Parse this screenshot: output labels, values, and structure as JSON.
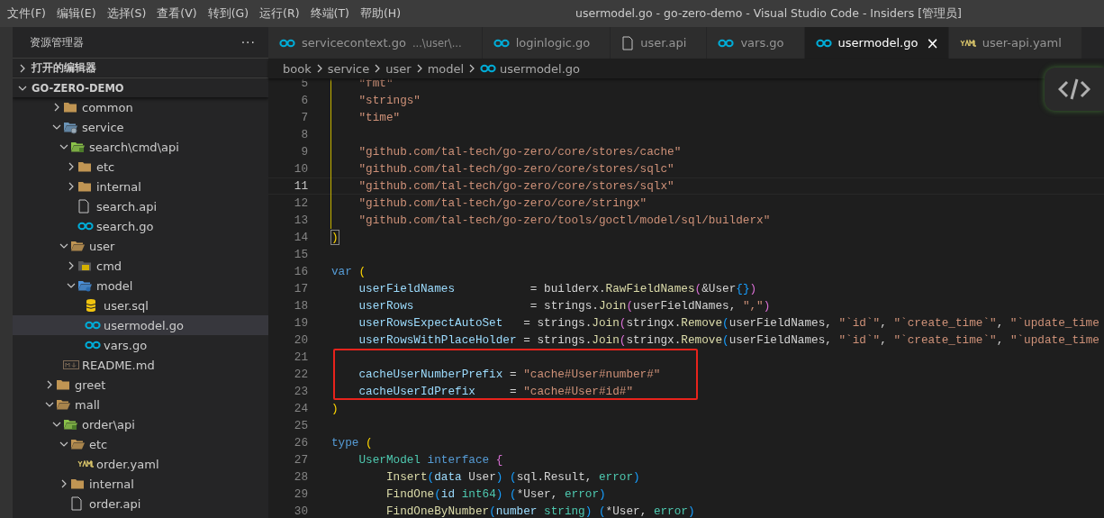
{
  "window": {
    "title": "usermodel.go - go-zero-demo - Visual Studio Code - Insiders [管理员]"
  },
  "menu": [
    "文件(F)",
    "编辑(E)",
    "选择(S)",
    "查看(V)",
    "转到(G)",
    "运行(R)",
    "终端(T)",
    "帮助(H)"
  ],
  "sidebar": {
    "title": "资源管理器",
    "more": "···",
    "sections": [
      {
        "label": "打开的编辑器",
        "expanded": false
      },
      {
        "label": "GO-ZERO-DEMO",
        "expanded": true
      }
    ],
    "tree": [
      {
        "children": [
          {
            "label": "common",
            "kind": "folder",
            "expanded": false,
            "selected": false
          },
          {
            "label": "service",
            "kind": "service-folder",
            "expanded": true,
            "selected": false,
            "children": [
              {
                "label": "search\\cmd\\api",
                "kind": "api-folder",
                "expanded": true,
                "selected": false,
                "children": [
                  {
                    "label": "etc",
                    "kind": "folder",
                    "expanded": false,
                    "selected": false
                  },
                  {
                    "label": "internal",
                    "kind": "folder",
                    "expanded": false,
                    "selected": false
                  },
                  {
                    "label": "search.api",
                    "kind": "file",
                    "selected": false
                  },
                  {
                    "label": "search.go",
                    "kind": "go",
                    "selected": false
                  }
                ]
              },
              {
                "label": "user",
                "kind": "folder",
                "expanded": true,
                "selected": false,
                "children": [
                  {
                    "label": "cmd",
                    "kind": "cmd-folder",
                    "expanded": false,
                    "selected": false
                  },
                  {
                    "label": "model",
                    "kind": "model-folder",
                    "expanded": true,
                    "selected": false,
                    "children": [
                      {
                        "label": "user.sql",
                        "kind": "sql",
                        "selected": false
                      },
                      {
                        "label": "usermodel.go",
                        "kind": "go",
                        "selected": true
                      },
                      {
                        "label": "vars.go",
                        "kind": "go",
                        "selected": false
                      }
                    ]
                  }
                ]
              }
            ]
          },
          {
            "label": "README.md",
            "kind": "md",
            "selected": false
          }
        ]
      },
      {
        "label": "greet",
        "kind": "folder",
        "expanded": false,
        "selected": false
      },
      {
        "label": "mall",
        "kind": "folder",
        "expanded": true,
        "selected": false,
        "children": [
          {
            "label": "order\\api",
            "kind": "api-folder",
            "expanded": true,
            "selected": false,
            "children": [
              {
                "label": "etc",
                "kind": "folder",
                "expanded": true,
                "selected": false,
                "children": [
                  {
                    "label": "order.yaml",
                    "kind": "yaml",
                    "selected": false
                  }
                ]
              },
              {
                "label": "internal",
                "kind": "folder",
                "expanded": false,
                "selected": false
              },
              {
                "label": "order.api",
                "kind": "file",
                "selected": false
              }
            ]
          }
        ]
      }
    ]
  },
  "tabs": [
    {
      "label": "servicecontext.go",
      "description": "...\\user\\...",
      "kind": "go",
      "selected": false
    },
    {
      "label": "loginlogic.go",
      "kind": "go",
      "selected": false
    },
    {
      "label": "user.api",
      "kind": "file",
      "selected": false
    },
    {
      "label": "vars.go",
      "kind": "go",
      "selected": false
    },
    {
      "label": "usermodel.go",
      "kind": "go",
      "selected": true,
      "close": "×"
    },
    {
      "label": "user-api.yaml",
      "kind": "yaml",
      "selected": false
    }
  ],
  "breadcrumbs": [
    "book",
    "service",
    "user",
    "model",
    "usermodel.go"
  ],
  "code": [
    {
      "n": "5",
      "guide": true,
      "tokens": [
        {
          "kind": "string",
          "text": "    \"fmt\""
        }
      ]
    },
    {
      "n": "6",
      "guide": true,
      "tokens": [
        {
          "kind": "string",
          "text": "    \"strings\""
        }
      ]
    },
    {
      "n": "7",
      "guide": true,
      "tokens": [
        {
          "kind": "string",
          "text": "    \"time\""
        }
      ]
    },
    {
      "n": "8",
      "guide": true
    },
    {
      "n": "9",
      "guide": true,
      "tokens": [
        {
          "kind": "string",
          "text": "    \"github.com/tal-tech/go-zero/core/stores/cache\""
        }
      ]
    },
    {
      "n": "10",
      "guide": true,
      "tokens": [
        {
          "kind": "string",
          "text": "    \"github.com/tal-tech/go-zero/core/stores/sqlc\""
        }
      ]
    },
    {
      "n": "11",
      "guide": true,
      "current": true,
      "tokens": [
        {
          "kind": "string",
          "text": "    \"github.com/tal-tech/go-zero/core/stores/sqlx\""
        }
      ]
    },
    {
      "n": "12",
      "guide": true,
      "tokens": [
        {
          "kind": "string",
          "text": "    \"github.com/tal-tech/go-zero/core/stringx\""
        }
      ]
    },
    {
      "n": "13",
      "guide": true,
      "tokens": [
        {
          "kind": "string",
          "text": "    \"github.com/tal-tech/go-zero/tools/goctl/model/sql/builderx\""
        }
      ]
    },
    {
      "n": "14",
      "tokens": [
        {
          "kind": "bracket-match",
          "text": ")"
        }
      ]
    },
    {
      "n": "15"
    },
    {
      "n": "16",
      "tokens": [
        {
          "kind": "keyword",
          "text": "var"
        },
        {
          "kind": "bracket1",
          "text": " ("
        }
      ]
    },
    {
      "n": "17",
      "tokens": [
        {
          "kind": "variable",
          "text": "    userFieldNames"
        },
        {
          "kind": "plain",
          "text": "           = builderx."
        },
        {
          "kind": "function",
          "text": "RawFieldNames"
        },
        {
          "kind": "bracket2",
          "text": "("
        },
        {
          "kind": "plain",
          "text": "&User"
        },
        {
          "kind": "bracket3",
          "text": "{}"
        },
        {
          "kind": "bracket2",
          "text": ")"
        }
      ]
    },
    {
      "n": "18",
      "tokens": [
        {
          "kind": "variable",
          "text": "    userRows"
        },
        {
          "kind": "plain",
          "text": "                 = strings."
        },
        {
          "kind": "function",
          "text": "Join"
        },
        {
          "kind": "bracket2",
          "text": "("
        },
        {
          "kind": "plain",
          "text": "userFieldNames, "
        },
        {
          "kind": "string",
          "text": "\",\""
        },
        {
          "kind": "bracket2",
          "text": ")"
        }
      ]
    },
    {
      "n": "19",
      "tokens": [
        {
          "kind": "variable",
          "text": "    userRowsExpectAutoSet"
        },
        {
          "kind": "plain",
          "text": "   = strings."
        },
        {
          "kind": "function",
          "text": "Join"
        },
        {
          "kind": "bracket2",
          "text": "("
        },
        {
          "kind": "plain",
          "text": "stringx."
        },
        {
          "kind": "function",
          "text": "Remove"
        },
        {
          "kind": "bracket3",
          "text": "("
        },
        {
          "kind": "plain",
          "text": "userFieldNames, "
        },
        {
          "kind": "string",
          "text": "\"`id`\""
        },
        {
          "kind": "plain",
          "text": ", "
        },
        {
          "kind": "string",
          "text": "\"`create_time`\""
        },
        {
          "kind": "plain",
          "text": ", "
        },
        {
          "kind": "string",
          "text": "\"`update_time"
        }
      ]
    },
    {
      "n": "20",
      "tokens": [
        {
          "kind": "variable",
          "text": "    userRowsWithPlaceHolder"
        },
        {
          "kind": "plain",
          "text": " = strings."
        },
        {
          "kind": "function",
          "text": "Join"
        },
        {
          "kind": "bracket2",
          "text": "("
        },
        {
          "kind": "plain",
          "text": "stringx."
        },
        {
          "kind": "function",
          "text": "Remove"
        },
        {
          "kind": "bracket3",
          "text": "("
        },
        {
          "kind": "plain",
          "text": "userFieldNames, "
        },
        {
          "kind": "string",
          "text": "\"`id`\""
        },
        {
          "kind": "plain",
          "text": ", "
        },
        {
          "kind": "string",
          "text": "\"`create_time`\""
        },
        {
          "kind": "plain",
          "text": ", "
        },
        {
          "kind": "string",
          "text": "\"`update_time"
        }
      ]
    },
    {
      "n": "21",
      "boxed": true
    },
    {
      "n": "22",
      "boxed": true,
      "tokens": [
        {
          "kind": "variable",
          "text": "    cacheUserNumberPrefix"
        },
        {
          "kind": "plain",
          "text": " = "
        },
        {
          "kind": "string",
          "text": "\"cache#User#number#\""
        }
      ]
    },
    {
      "n": "23",
      "boxed": true,
      "tokens": [
        {
          "kind": "variable",
          "text": "    cacheUserIdPrefix"
        },
        {
          "kind": "plain",
          "text": "     = "
        },
        {
          "kind": "string",
          "text": "\"cache#User#id#\""
        }
      ]
    },
    {
      "n": "24",
      "tokens": [
        {
          "kind": "bracket1",
          "text": ")"
        }
      ]
    },
    {
      "n": "25"
    },
    {
      "n": "26",
      "tokens": [
        {
          "kind": "keyword",
          "text": "type"
        },
        {
          "kind": "bracket1",
          "text": " ("
        }
      ]
    },
    {
      "n": "27",
      "tokens": [
        {
          "kind": "type",
          "text": "    UserModel"
        },
        {
          "kind": "keyword",
          "text": " interface"
        },
        {
          "kind": "bracket2",
          "text": " {"
        }
      ]
    },
    {
      "n": "28",
      "tokens": [
        {
          "kind": "function",
          "text": "        Insert"
        },
        {
          "kind": "bracket3",
          "text": "("
        },
        {
          "kind": "variable",
          "text": "data"
        },
        {
          "kind": "plain",
          "text": " User"
        },
        {
          "kind": "bracket3",
          "text": ")"
        },
        {
          "kind": "bracket3",
          "text": " ("
        },
        {
          "kind": "plain",
          "text": "sql.Result, "
        },
        {
          "kind": "type",
          "text": "error"
        },
        {
          "kind": "bracket3",
          "text": ")"
        }
      ]
    },
    {
      "n": "29",
      "tokens": [
        {
          "kind": "function",
          "text": "        FindOne"
        },
        {
          "kind": "bracket3",
          "text": "("
        },
        {
          "kind": "variable",
          "text": "id"
        },
        {
          "kind": "type",
          "text": " int64"
        },
        {
          "kind": "bracket3",
          "text": ")"
        },
        {
          "kind": "bracket3",
          "text": " ("
        },
        {
          "kind": "plain",
          "text": "*User, "
        },
        {
          "kind": "type",
          "text": "error"
        },
        {
          "kind": "bracket3",
          "text": ")"
        }
      ]
    },
    {
      "n": "30",
      "tokens": [
        {
          "kind": "function",
          "text": "        FindOneByNumber"
        },
        {
          "kind": "bracket3",
          "text": "("
        },
        {
          "kind": "variable",
          "text": "number"
        },
        {
          "kind": "type",
          "text": " string"
        },
        {
          "kind": "bracket3",
          "text": ")"
        },
        {
          "kind": "bracket3",
          "text": " ("
        },
        {
          "kind": "plain",
          "text": "*User, "
        },
        {
          "kind": "type",
          "text": "error"
        },
        {
          "kind": "bracket3",
          "text": ")"
        }
      ]
    }
  ]
}
